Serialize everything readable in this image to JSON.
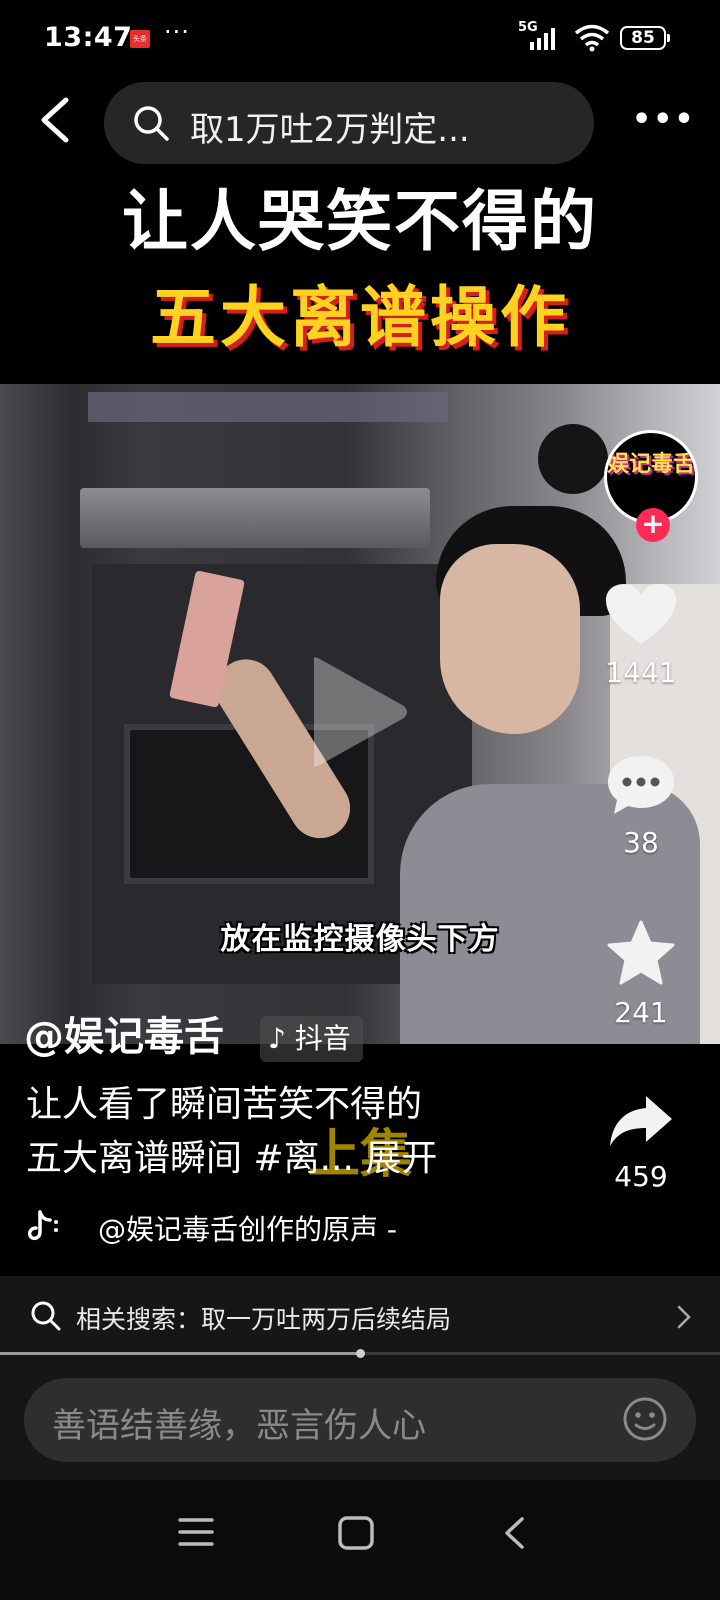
{
  "status_bar": {
    "time": "13:47",
    "app_badge": "头条",
    "more_dots": "···",
    "network": "5G",
    "battery": "85"
  },
  "top_bar": {
    "search_query": "取1万吐2万判定..."
  },
  "video": {
    "title_line1": "让人哭笑不得的",
    "title_line2": "五大离谱操作",
    "subtitle": "放在监控摄像头下方",
    "avatar_text": "娱记毒舌"
  },
  "actions": {
    "likes": "1441",
    "comments": "38",
    "favorites": "241",
    "shares": "459"
  },
  "info": {
    "author": "@娱记毒舌",
    "platform": "抖音",
    "description_line1": "让人看了瞬间苦笑不得的",
    "description_line2_text": "五大离谱瞬间 ",
    "hashtag": "#离...",
    "expand": " 展开",
    "watermark": "上集",
    "music": "@娱记毒舌创作的原声 -"
  },
  "related_search": {
    "label": "相关搜索：取一万吐两万后续结局"
  },
  "progress": {
    "fraction": 0.5
  },
  "comment_bar": {
    "placeholder": "善语结善缘，恶言伤人心"
  },
  "colors": {
    "accent": "#fe2c55",
    "title_yellow": "#ffd21f",
    "title_red_shadow": "#d61e1e"
  },
  "icons": [
    "back-arrow-icon",
    "search-icon",
    "more-icon",
    "play-icon",
    "heart-icon",
    "comment-icon",
    "star-icon",
    "share-icon",
    "douyin-logo-icon",
    "chevron-right-icon",
    "emoji-icon",
    "menu-icon",
    "home-icon",
    "nav-back-icon"
  ]
}
